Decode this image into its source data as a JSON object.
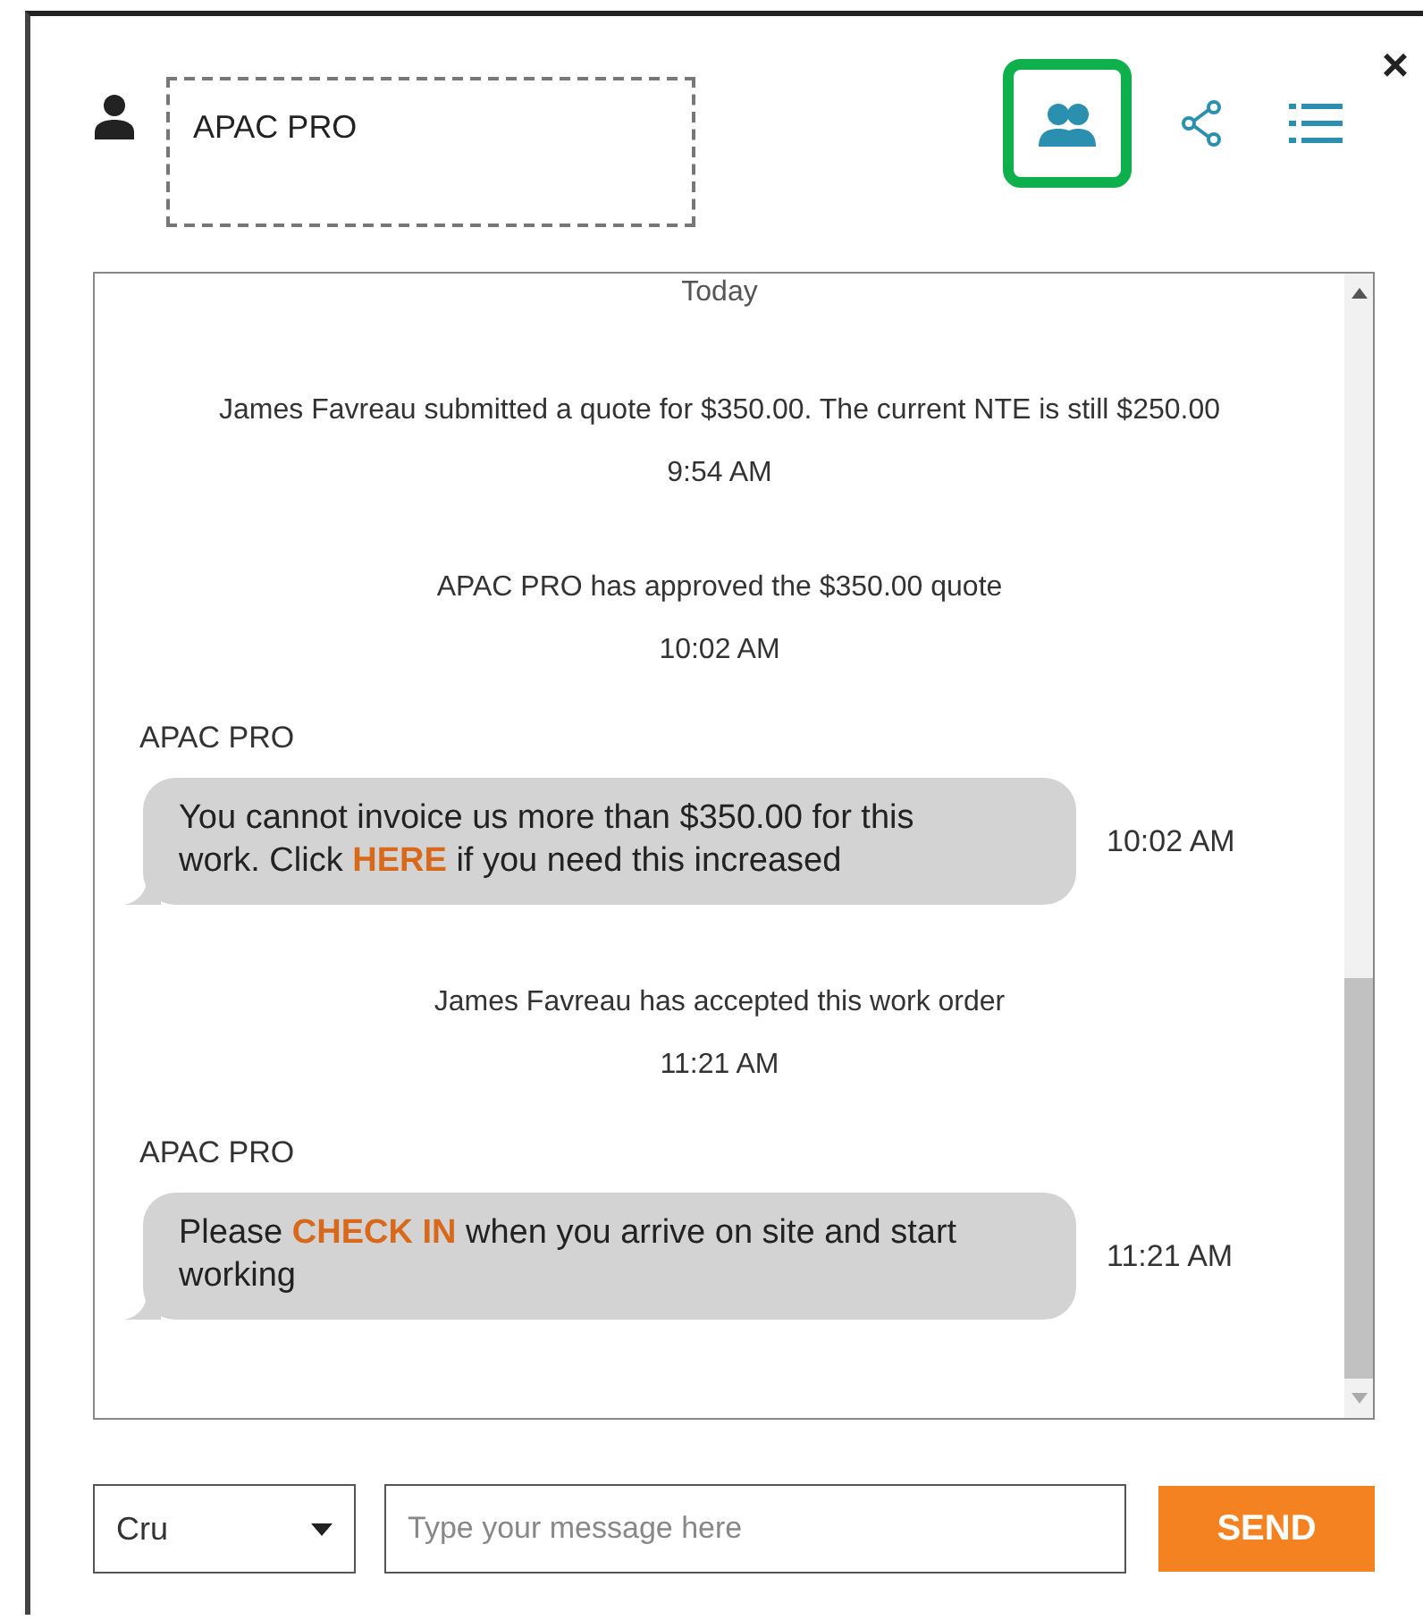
{
  "header": {
    "name": "APAC PRO"
  },
  "toolbar": [
    {
      "kind": "group",
      "highlighted": true
    },
    {
      "kind": "share",
      "highlighted": false
    },
    {
      "kind": "list",
      "highlighted": false
    }
  ],
  "close": "×",
  "log": [
    {
      "kind": "date",
      "text": "Today"
    },
    {
      "kind": "event",
      "text": "James Favreau submitted a quote for $350.00. The current NTE is still $250.00",
      "time": "9:54 AM"
    },
    {
      "kind": "event",
      "text": "APAC PRO has approved the $350.00 quote",
      "time": "10:02 AM"
    },
    {
      "kind": "message",
      "sender": "APAC PRO",
      "text": "You cannot invoice us more than $350.00 for this work. Click **HERE** if you need this increased",
      "time": "10:02 AM"
    },
    {
      "kind": "event",
      "text": "James Favreau has accepted this work order",
      "time": "11:21 AM"
    },
    {
      "kind": "message",
      "sender": "APAC PRO",
      "text": "Please **CHECK IN** when you arrive on site and start working",
      "time": "11:21 AM"
    }
  ],
  "composer": {
    "recipient": "Cru",
    "placeholder": "Type your message here",
    "send": "SEND"
  }
}
